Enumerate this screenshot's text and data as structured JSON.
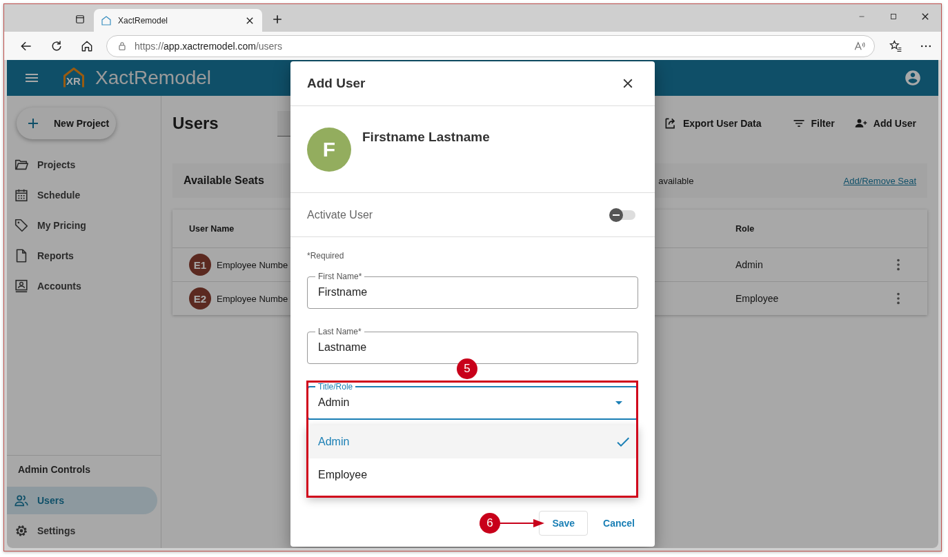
{
  "browser": {
    "tab_title": "XactRemodel",
    "url_scheme": "https://",
    "url_host": "app.xactremodel.com",
    "url_path": "/users"
  },
  "app": {
    "logo_mark": "XR",
    "title": "XactRemodel"
  },
  "sidebar": {
    "new_button": "New Project",
    "items": [
      {
        "label": "Projects",
        "selected": false
      },
      {
        "label": "Schedule",
        "selected": false
      },
      {
        "label": "My Pricing",
        "selected": false
      },
      {
        "label": "Reports",
        "selected": false
      },
      {
        "label": "Accounts",
        "selected": false
      }
    ],
    "section_title": "Admin Controls",
    "admin_items": [
      {
        "label": "Users",
        "selected": true
      },
      {
        "label": "Settings",
        "selected": false
      }
    ]
  },
  "page": {
    "title": "Users",
    "actions": [
      "Export User Data",
      "Filter",
      "Add User"
    ],
    "seats": {
      "title": "Available Seats",
      "text": "available",
      "link": "Add/Remove Seat"
    }
  },
  "table": {
    "columns": [
      "User Name",
      "Role"
    ],
    "rows": [
      {
        "initials": "E1",
        "name": "Employee Numbe",
        "role": "Admin"
      },
      {
        "initials": "E2",
        "name": "Employee Numbe",
        "role": "Employee"
      }
    ]
  },
  "dialog": {
    "title": "Add User",
    "avatar_letter": "F",
    "full_name": "Firstname Lastname",
    "activate": {
      "label": "Activate User",
      "on": false
    },
    "required_note": "*Required",
    "fields": [
      {
        "label": "First Name*",
        "value": "Firstname"
      },
      {
        "label": "Last Name*",
        "value": "Lastname"
      }
    ],
    "select": {
      "label": "Title/Role",
      "value": "Admin",
      "options": [
        {
          "label": "Admin",
          "selected": true
        },
        {
          "label": "Employee",
          "selected": false
        }
      ]
    },
    "buttons": [
      "Save",
      "Cancel"
    ]
  },
  "annotations": [
    {
      "number": "5"
    },
    {
      "number": "6"
    }
  ]
}
